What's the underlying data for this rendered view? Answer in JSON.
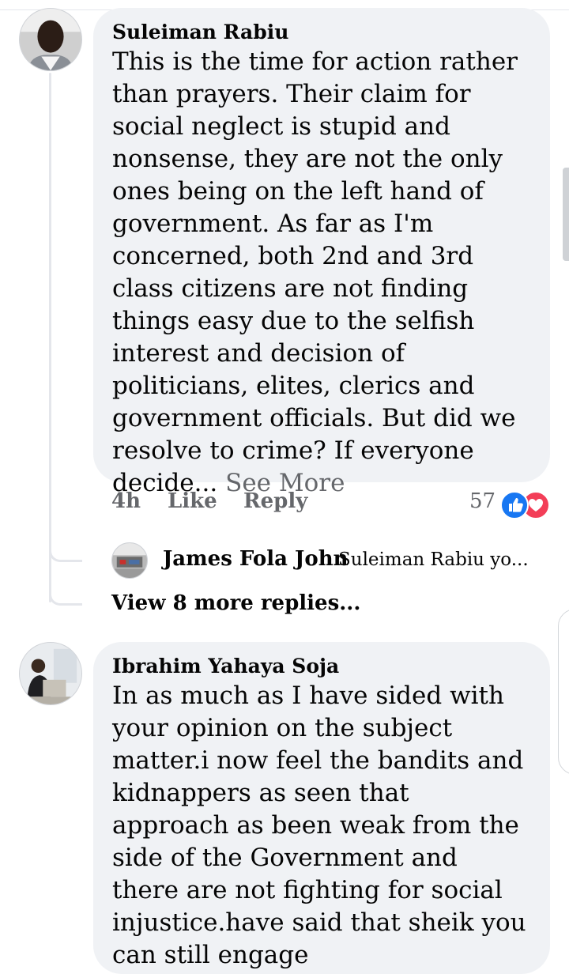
{
  "comments": [
    {
      "author": "Suleiman Rabiu",
      "text": "This is the time for action rather than prayers. Their claim for social neglect is stupid and nonsense, they are not the only ones being on the left hand of government. As far as I'm concerned, both 2nd and 3rd class citizens are not finding things easy due to the selfish interest and decision of politicians, elites, clerics and government officials. But did we resolve to crime? If everyone decide...",
      "see_more": "See More",
      "time": "4h",
      "like_label": "Like",
      "reply_label": "Reply",
      "reaction_count": "57",
      "reactions": [
        "like-icon",
        "love-icon"
      ],
      "reply_preview": {
        "author": "James Fola John",
        "snippet": "Suleiman Rabiu yo..."
      },
      "view_more_replies": "View 8 more replies..."
    },
    {
      "author": "Ibrahim Yahaya Soja",
      "text": "In as much as I have sided with your opinion on the subject matter.i now feel the bandits and kidnappers as seen that approach as been weak from the side of the Government and there are not fighting for social injustice.have said that sheik you can still engage"
    }
  ],
  "colors": {
    "bubble": "#f0f2f5",
    "secondary_text": "#65676b",
    "like_blue": "#1877f2",
    "love_red": "#f33e58"
  }
}
